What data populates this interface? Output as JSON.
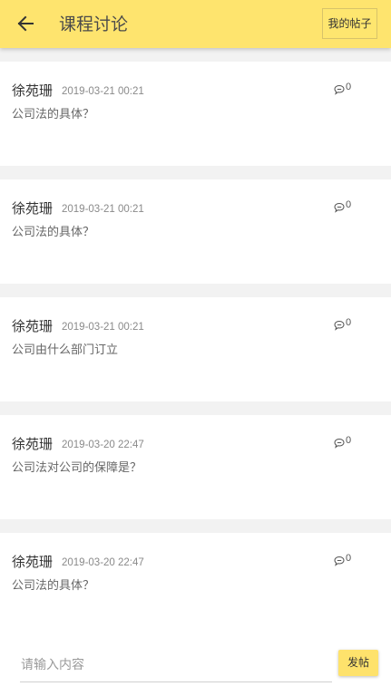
{
  "header": {
    "title": "课程讨论",
    "my_posts_label": "我的帖子"
  },
  "posts": [
    {
      "author": "徐苑珊",
      "time": "2019-03-21 00:21",
      "content": "公司法的具体？",
      "comments": "0"
    },
    {
      "author": "徐苑珊",
      "time": "2019-03-21 00:21",
      "content": "公司法的具体？",
      "comments": "0"
    },
    {
      "author": "徐苑珊",
      "time": "2019-03-21 00:21",
      "content": "公司由什么部门订立",
      "comments": "0"
    },
    {
      "author": "徐苑珊",
      "time": "2019-03-20 22:47",
      "content": "公司法对公司的保障是？",
      "comments": "0"
    },
    {
      "author": "徐苑珊",
      "time": "2019-03-20 22:47",
      "content": "公司法的具体？",
      "comments": "0"
    }
  ],
  "input_bar": {
    "placeholder": "请输入内容",
    "value": "",
    "submit_label": "发帖"
  },
  "colors": {
    "header_bg": "#fee46e",
    "accent": "#fee26c",
    "page_bg": "#f2f2f2"
  },
  "icons": {
    "back": "arrow-left-icon",
    "comment": "comment-bubble-icon"
  }
}
